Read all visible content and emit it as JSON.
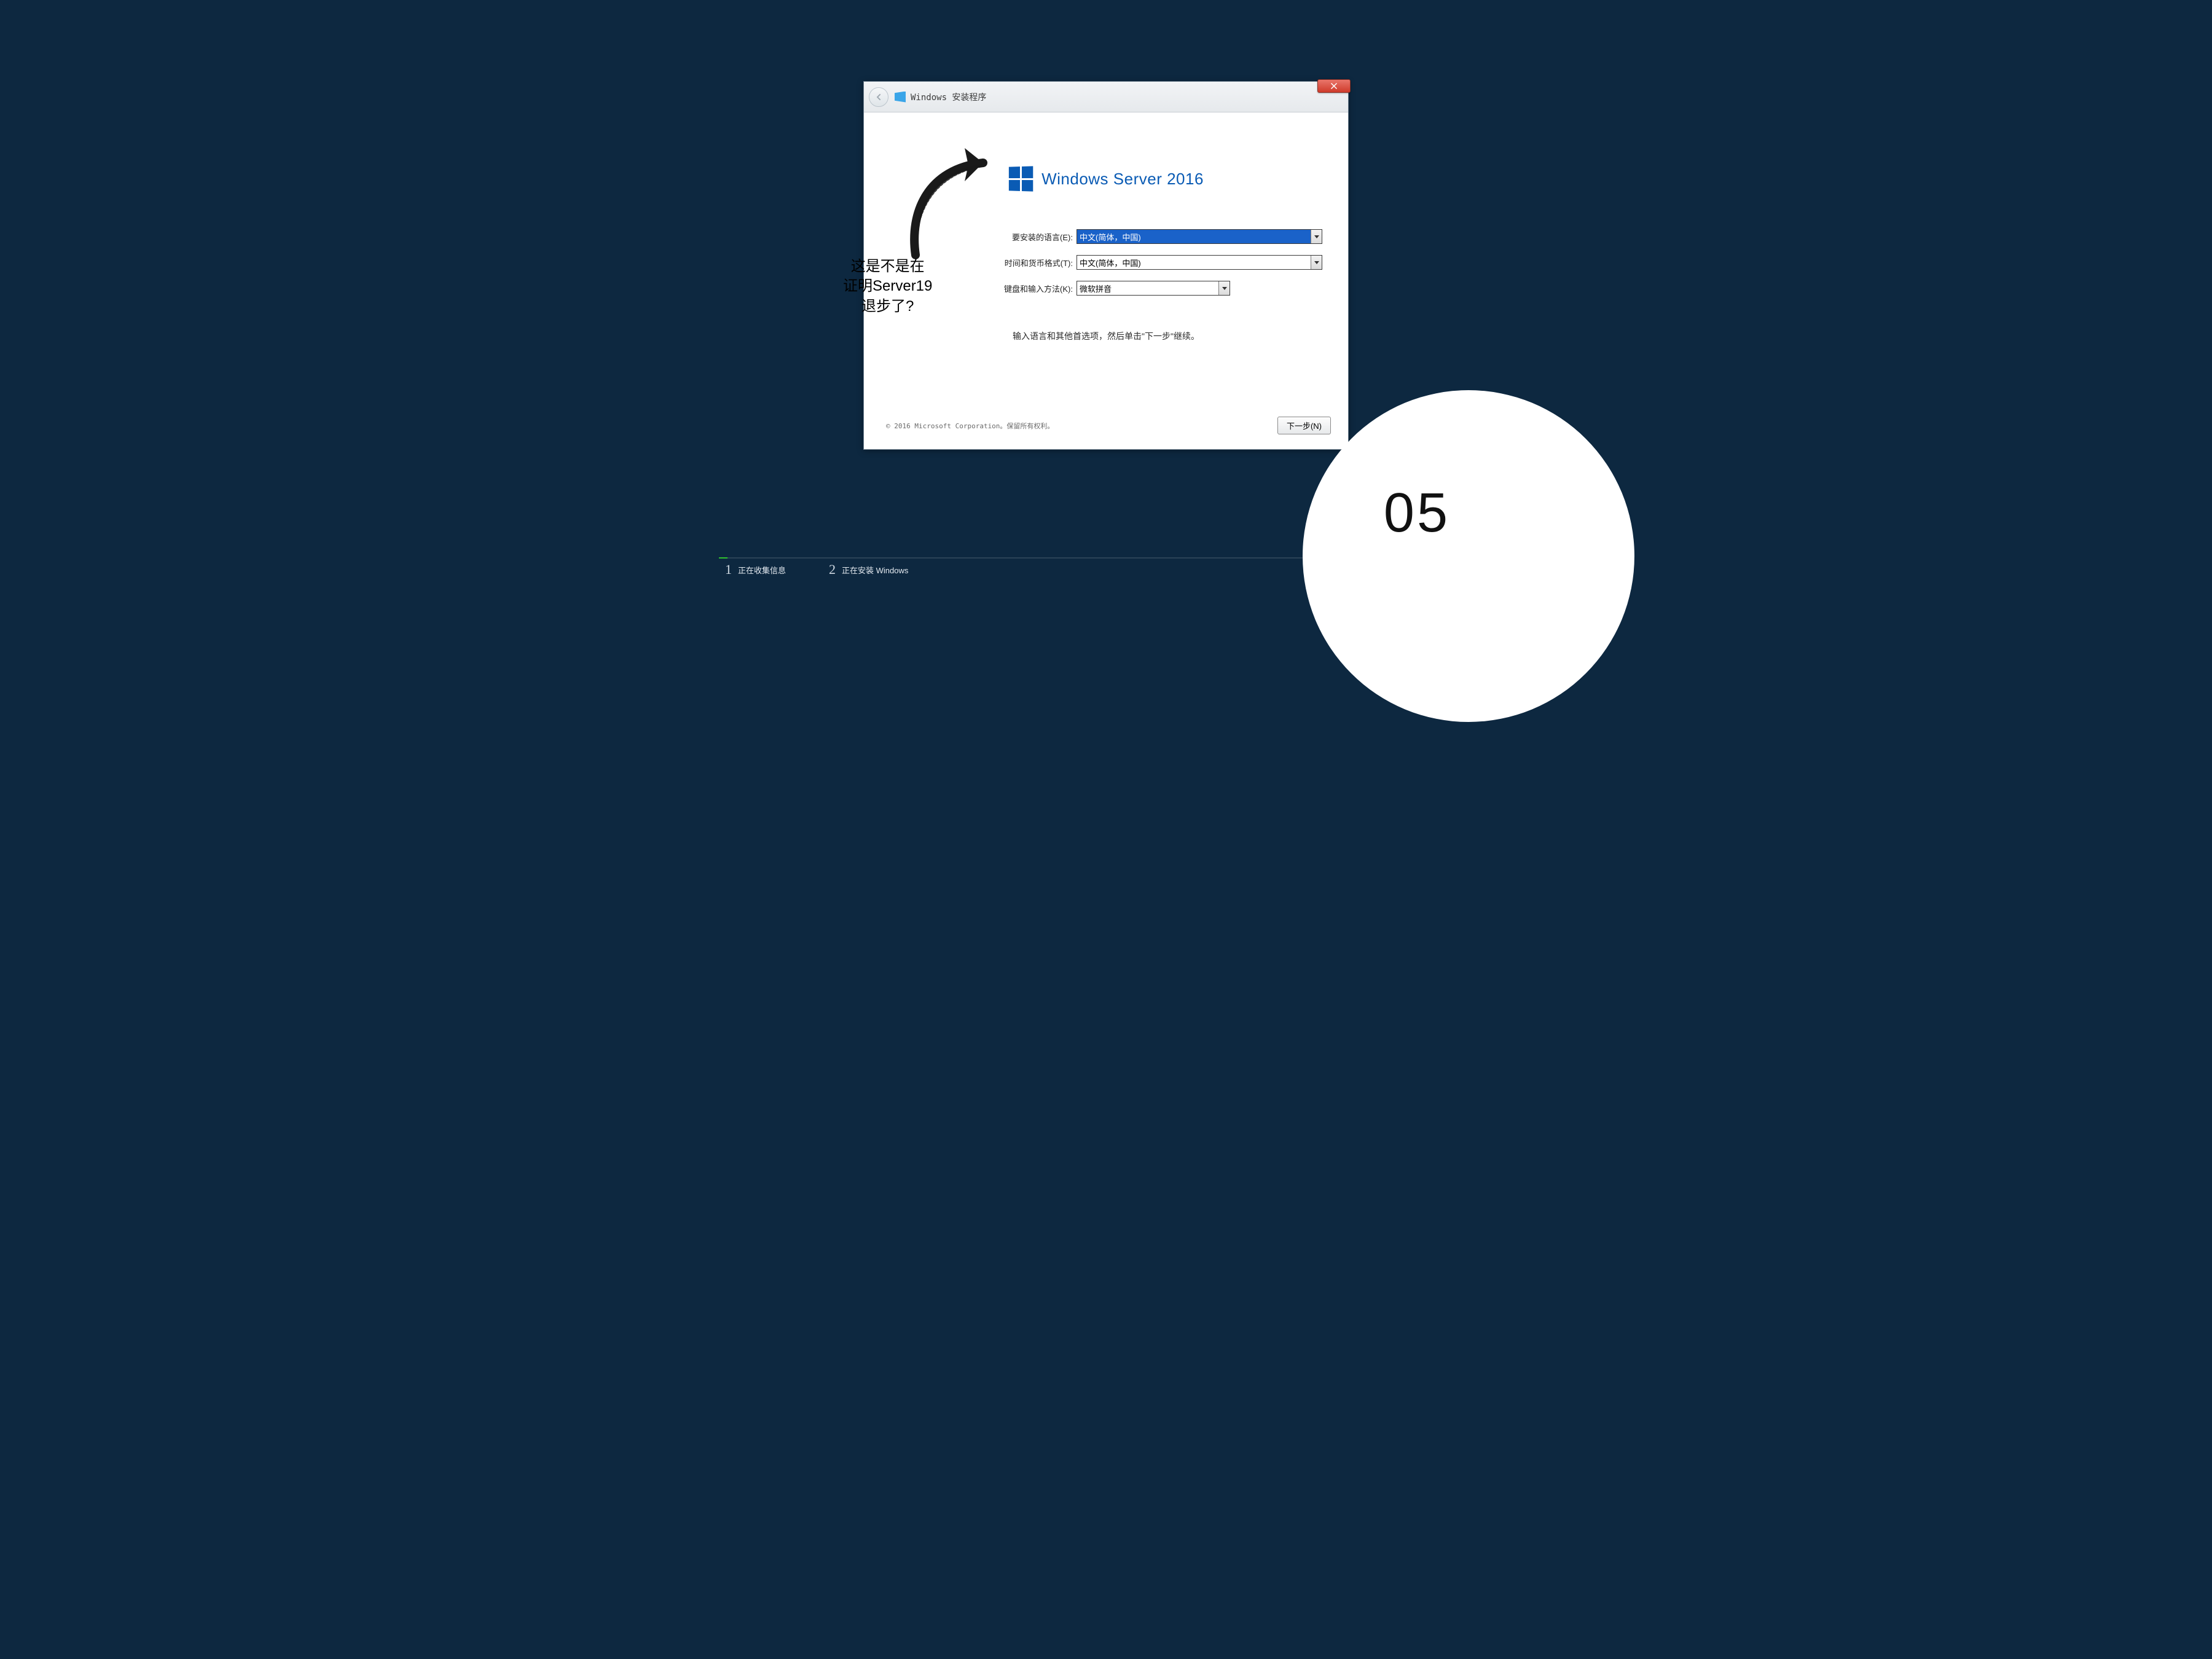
{
  "window": {
    "title": "Windows 安装程序"
  },
  "brand": {
    "text": "Windows Server 2016"
  },
  "form": {
    "language_label": "要安装的语言(E):",
    "language_value": "中文(简体，中国)",
    "time_label": "时间和货币格式(T):",
    "time_value": "中文(简体，中国)",
    "keyboard_label": "键盘和输入方法(K):",
    "keyboard_value": "微软拼音"
  },
  "instruction": "输入语言和其他首选项，然后单击\"下一步\"继续。",
  "copyright": "© 2016 Microsoft Corporation。保留所有权利。",
  "next_button": "下一步(N)",
  "steps": {
    "s1_num": "1",
    "s1_label": "正在收集信息",
    "s2_num": "2",
    "s2_label": "正在安装 Windows"
  },
  "annotation": {
    "line1": "这是不是在",
    "line2": "证明Server19",
    "line3": "退步了?"
  },
  "slide_number": "05"
}
